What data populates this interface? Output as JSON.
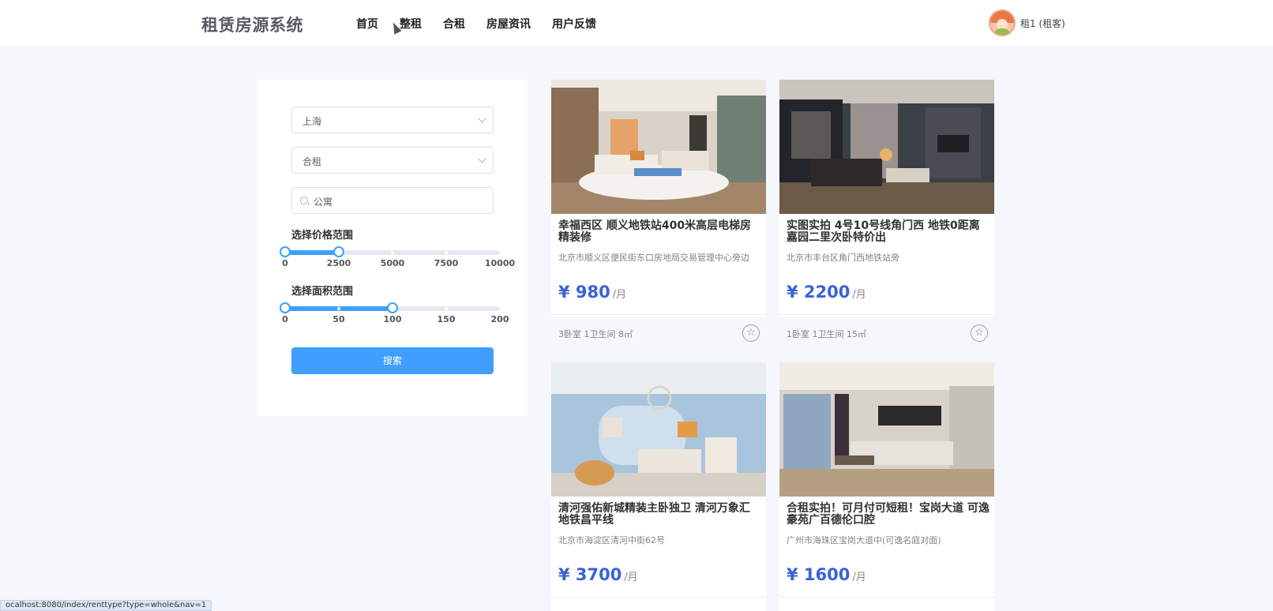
{
  "header": {
    "brand": "租赁房源系统",
    "nav": [
      "首页",
      "整租",
      "合租",
      "房屋资讯",
      "用户反馈"
    ],
    "user_label": "租1 (租客)"
  },
  "filter": {
    "city": "上海",
    "rent_type": "合租",
    "keyword": "公寓",
    "price_label": "选择价格范围",
    "price_ticks": [
      "0",
      "2500",
      "5000",
      "7500",
      "10000"
    ],
    "price_range": [
      0,
      2500
    ],
    "price_max": 10000,
    "area_label": "选择面积范围",
    "area_ticks": [
      "0",
      "50",
      "100",
      "150",
      "200"
    ],
    "area_range": [
      0,
      100
    ],
    "area_max": 200,
    "search_button": "搜索"
  },
  "listings": [
    {
      "title": "幸福西区 顺义地铁站400米高层电梯房 精装修",
      "address": "北京市顺义区便民街东口房地局交易管理中心旁边",
      "price": "¥ 980",
      "unit": "/月",
      "meta": "3卧室 1卫生间 8㎡"
    },
    {
      "title": "实图实拍 4号10号线角门西 地铁0距离 嘉园二里次卧特价出",
      "address": "北京市丰台区角门西地铁站旁",
      "price": "¥ 2200",
      "unit": "/月",
      "meta": "1卧室 1卫生间 15㎡"
    },
    {
      "title": "清河强佑新城精装主卧独卫 清河万象汇 地铁昌平线",
      "address": "北京市海淀区清河中街62号",
      "price": "¥ 3700",
      "unit": "/月",
      "meta": ""
    },
    {
      "title": "合租实拍！可月付可短租！宝岗大道 可逸豪苑广百德伦口腔",
      "address": "广州市海珠区宝岗大道中(可逸名庭对面)",
      "price": "¥ 1600",
      "unit": "/月",
      "meta": ""
    }
  ],
  "status_url": "ocalhost:8080/index/renttype?type=whole&nav=1",
  "colors": {
    "accent": "#409eff",
    "price": "#3a62d8",
    "background": "#f5f7fc"
  },
  "icons": [
    "chevron-down-icon",
    "search-icon",
    "star-icon",
    "avatar"
  ]
}
